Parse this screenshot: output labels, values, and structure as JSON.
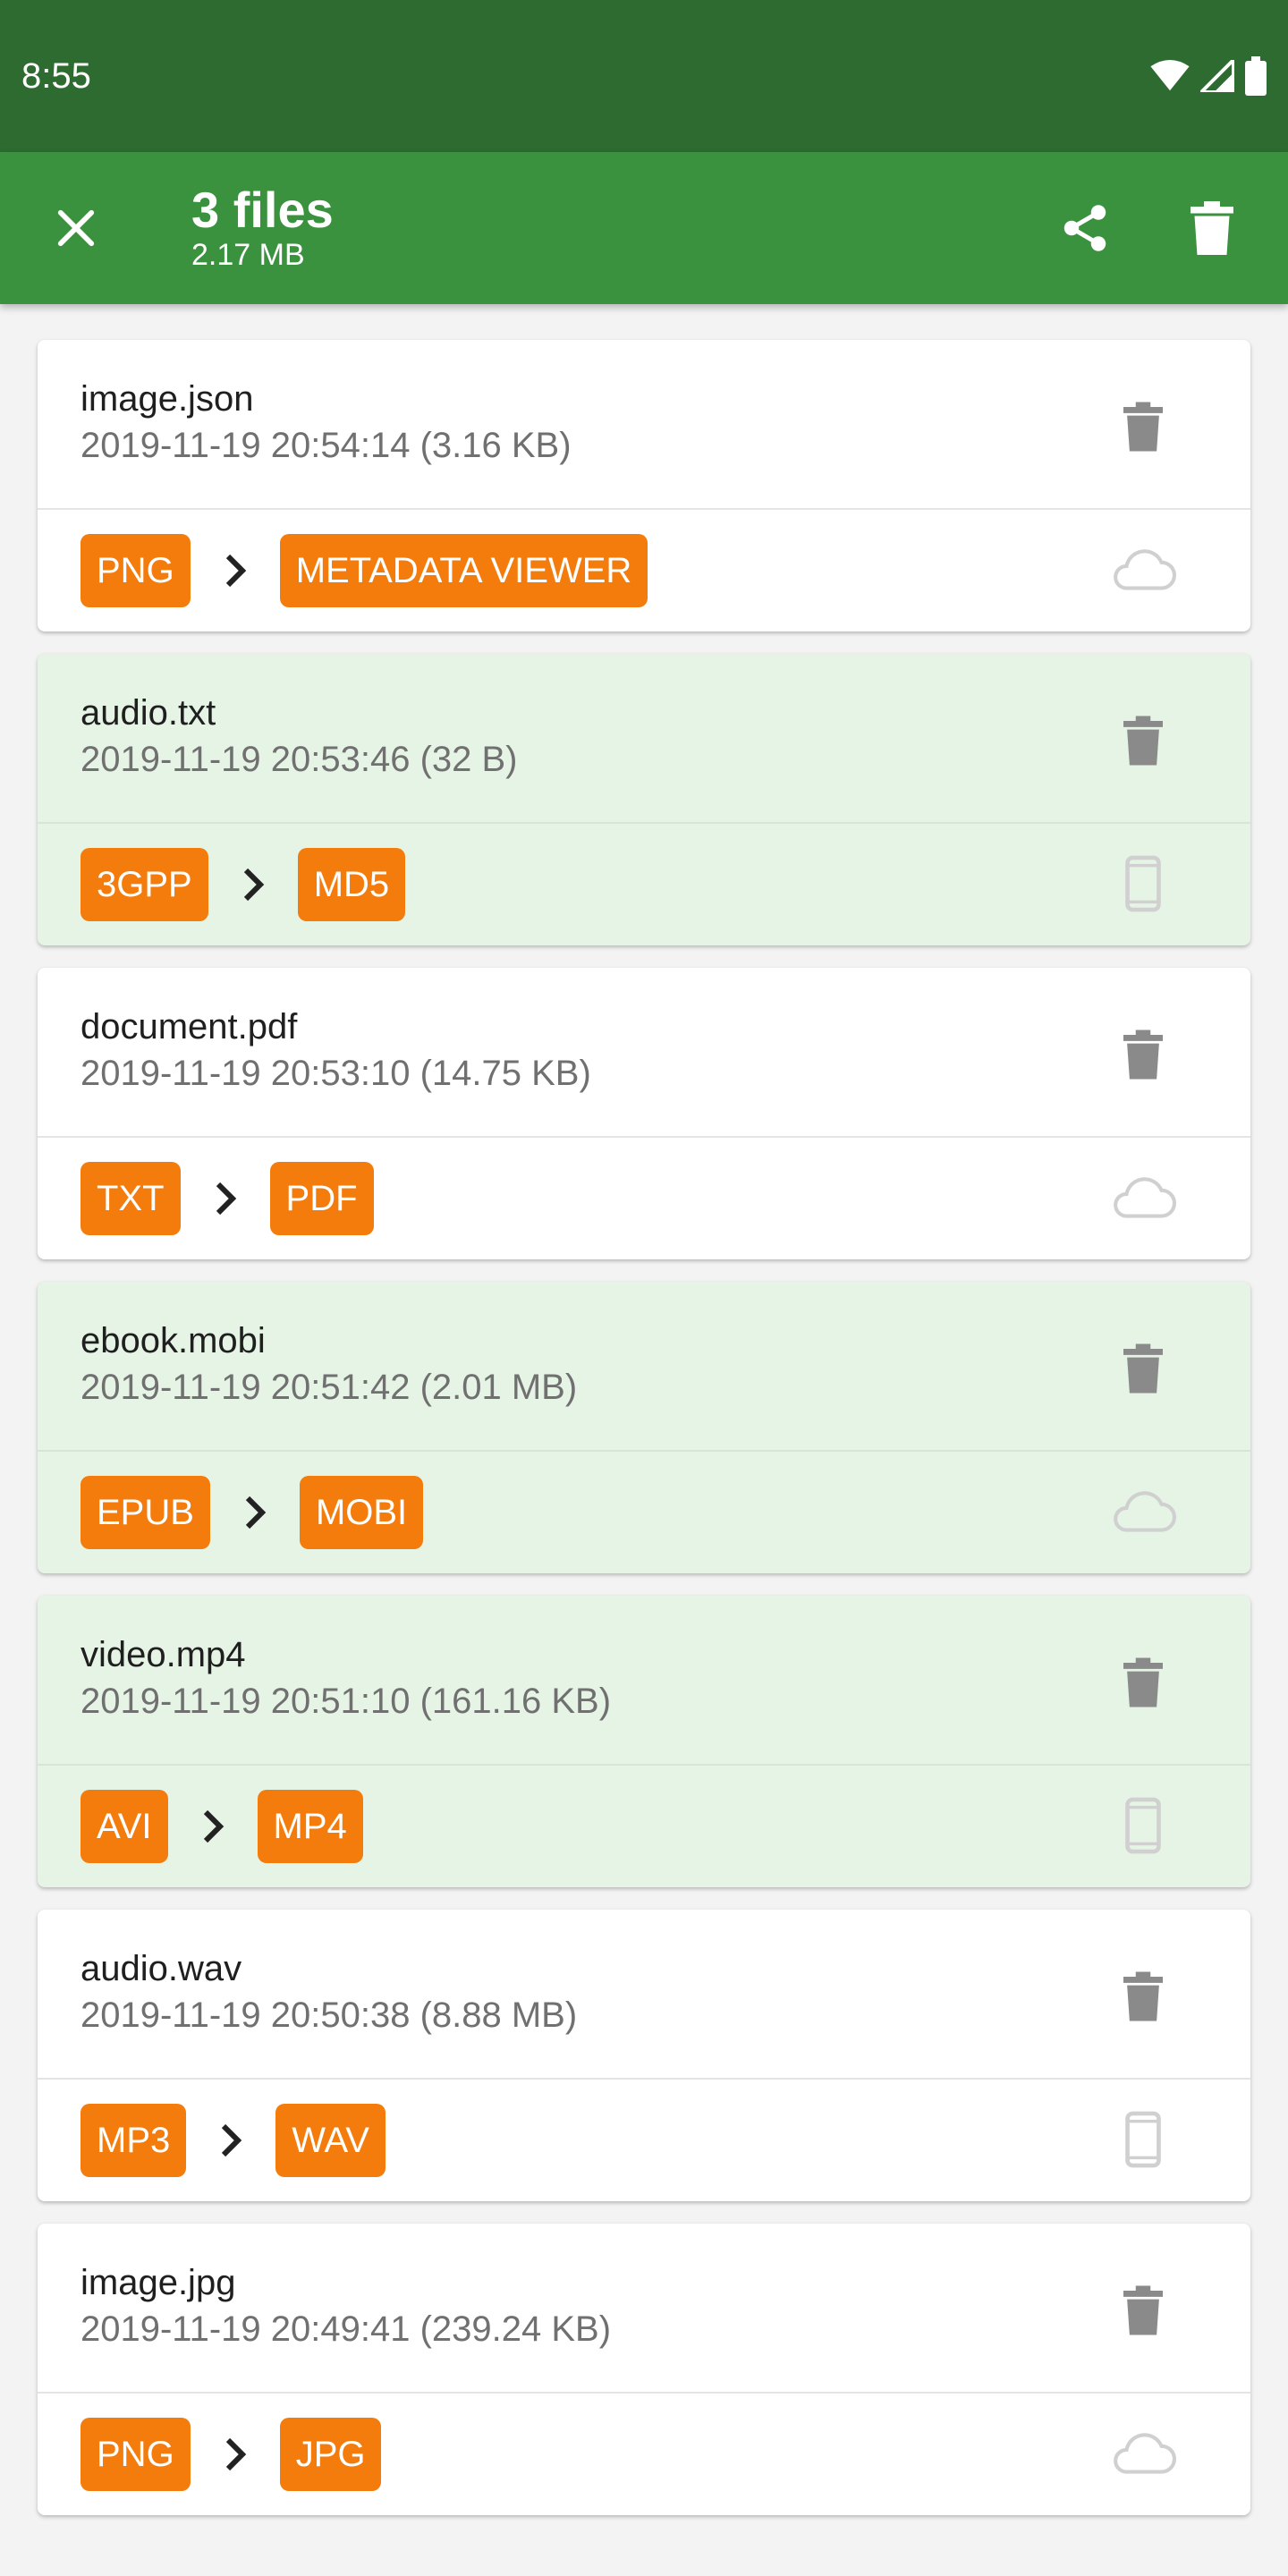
{
  "status": {
    "time": "8:55"
  },
  "header": {
    "title": "3 files",
    "subtitle": "2.17 MB"
  },
  "colors": {
    "status_bar": "#2e6b30",
    "app_bar": "#3a923e",
    "chip": "#f37c0c",
    "selected_card": "#e6f4e6"
  },
  "files": [
    {
      "name": "image.json",
      "meta": "2019-11-19 20:54:14 (3.16 KB)",
      "from": "PNG",
      "to": "METADATA VIEWER",
      "storage": "cloud-icon",
      "selected": false
    },
    {
      "name": "audio.txt",
      "meta": "2019-11-19 20:53:46 (32 B)",
      "from": "3GPP",
      "to": "MD5",
      "storage": "phone-icon",
      "selected": true
    },
    {
      "name": "document.pdf",
      "meta": "2019-11-19 20:53:10 (14.75 KB)",
      "from": "TXT",
      "to": "PDF",
      "storage": "cloud-icon",
      "selected": false
    },
    {
      "name": "ebook.mobi",
      "meta": "2019-11-19 20:51:42 (2.01 MB)",
      "from": "EPUB",
      "to": "MOBI",
      "storage": "cloud-icon",
      "selected": true
    },
    {
      "name": "video.mp4",
      "meta": "2019-11-19 20:51:10 (161.16 KB)",
      "from": "AVI",
      "to": "MP4",
      "storage": "phone-icon",
      "selected": true
    },
    {
      "name": "audio.wav",
      "meta": "2019-11-19 20:50:38 (8.88 MB)",
      "from": "MP3",
      "to": "WAV",
      "storage": "phone-icon",
      "selected": false
    },
    {
      "name": "image.jpg",
      "meta": "2019-11-19 20:49:41 (239.24 KB)",
      "from": "PNG",
      "to": "JPG",
      "storage": "cloud-icon",
      "selected": false
    }
  ]
}
